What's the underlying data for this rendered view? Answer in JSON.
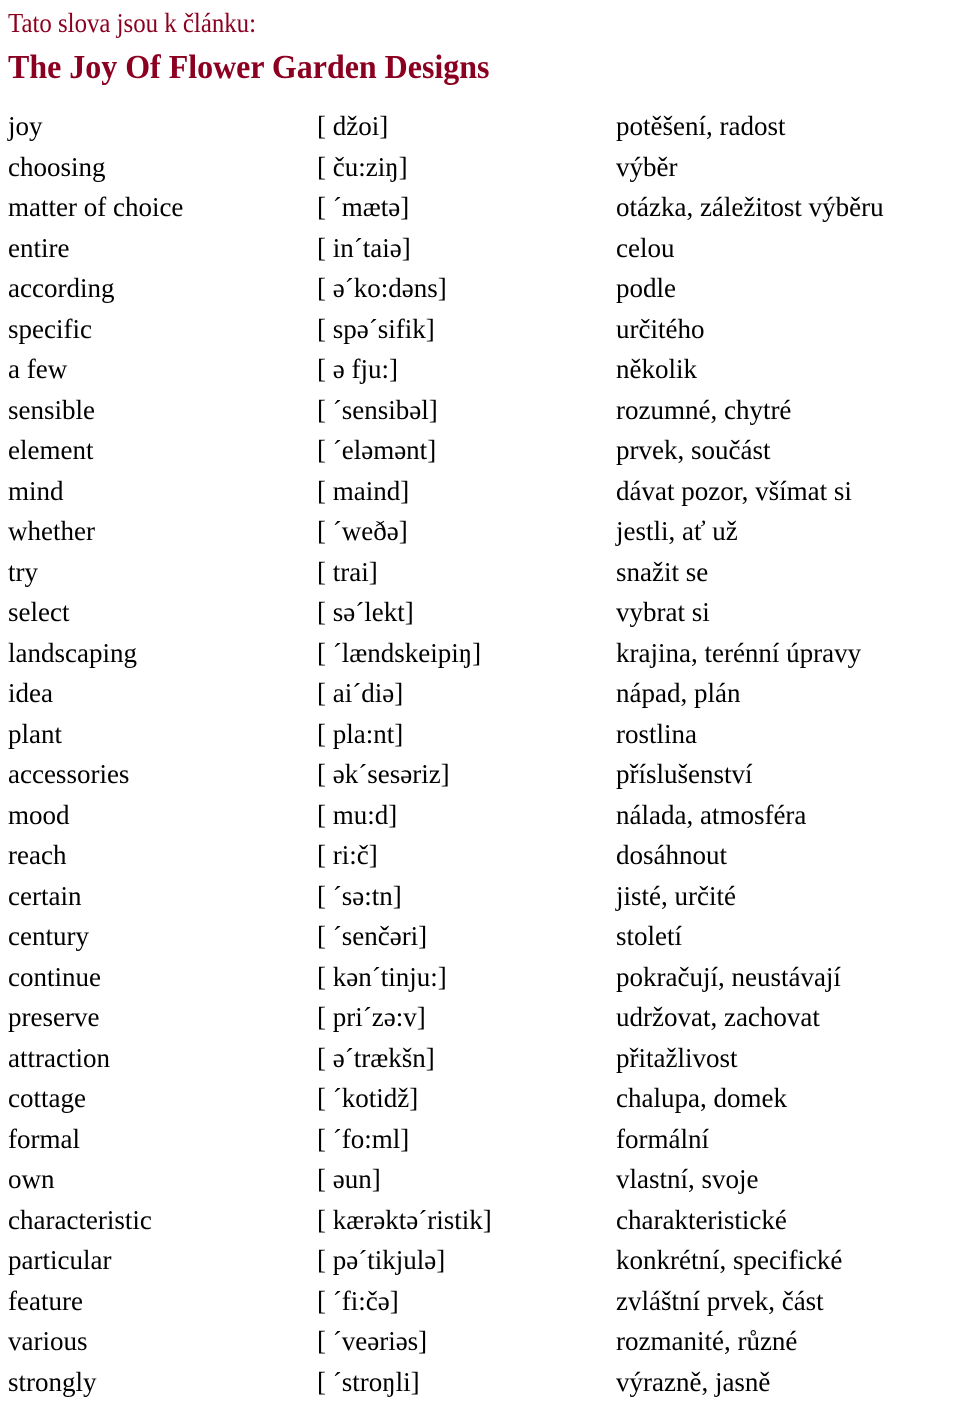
{
  "header": {
    "intro_line": "Tato slova jsou k článku:",
    "title": "The Joy Of Flower Garden Designs",
    "title_color": "#8B0020"
  },
  "vocabulary": {
    "rows": [
      {
        "term": "joy",
        "phonetic": "[ džoi]",
        "meaning": "potěšení, radost"
      },
      {
        "term": "choosing",
        "phonetic": "[ ču:ziŋ]",
        "meaning": "výběr"
      },
      {
        "term": "matter of choice",
        "phonetic": "[ ´mætə]",
        "meaning": "otázka, záležitost výběru"
      },
      {
        "term": "entire",
        "phonetic": "[ in´taiə]",
        "meaning": "celou"
      },
      {
        "term": "according",
        "phonetic": "[ ə´ko:dəns]",
        "meaning": "podle"
      },
      {
        "term": "specific",
        "phonetic": "[ spə´sifik]",
        "meaning": "určitého"
      },
      {
        "term": "a few",
        "phonetic": "[ ə fju:]",
        "meaning": "několik"
      },
      {
        "term": "sensible",
        "phonetic": "[ ´sensibəl]",
        "meaning": "rozumné, chytré"
      },
      {
        "term": "element",
        "phonetic": "[ ´eləmənt]",
        "meaning": "prvek, součást"
      },
      {
        "term": "mind",
        "phonetic": "[ maind]",
        "meaning": "dávat pozor, všímat si"
      },
      {
        "term": "whether",
        "phonetic": "[ ´weðə]",
        "meaning": "jestli, ať už"
      },
      {
        "term": "try",
        "phonetic": "[ trai]",
        "meaning": "snažit se"
      },
      {
        "term": "select",
        "phonetic": "[ sə´lekt]",
        "meaning": "vybrat si"
      },
      {
        "term": "landscaping",
        "phonetic": "[ ´lændskeipiŋ]",
        "meaning": "krajina, terénní úpravy"
      },
      {
        "term": "idea",
        "phonetic": "[ ai´diə]",
        "meaning": "nápad, plán"
      },
      {
        "term": "plant",
        "phonetic": "[ pla:nt]",
        "meaning": "rostlina"
      },
      {
        "term": "accessories",
        "phonetic": "[ ək´sesəriz]",
        "meaning": "příslušenství"
      },
      {
        "term": "mood",
        "phonetic": "[ mu:d]",
        "meaning": "nálada, atmosféra"
      },
      {
        "term": "reach",
        "phonetic": "[ ri:č]",
        "meaning": "dosáhnout"
      },
      {
        "term": "certain",
        "phonetic": "[ ´sə:tn]",
        "meaning": "jisté, určité"
      },
      {
        "term": "century",
        "phonetic": "[ ´senčəri]",
        "meaning": "století"
      },
      {
        "term": "continue",
        "phonetic": "[ kən´tinju:]",
        "meaning": "pokračují, neustávají"
      },
      {
        "term": "preserve",
        "phonetic": "[ pri´zə:v]",
        "meaning": "udržovat, zachovat"
      },
      {
        "term": "attraction",
        "phonetic": "[ ə´trækšn]",
        "meaning": "přitažlivost"
      },
      {
        "term": "cottage",
        "phonetic": "[ ´kotidž]",
        "meaning": "chalupa, domek"
      },
      {
        "term": "formal",
        "phonetic": "[ ´fo:ml]",
        "meaning": "formální"
      },
      {
        "term": "own",
        "phonetic": "[ əun]",
        "meaning": "vlastní, svoje"
      },
      {
        "term": "characteristic",
        "phonetic": "[ kærəktə´ristik]",
        "meaning": "charakteristické"
      },
      {
        "term": "particular",
        "phonetic": "[ pə´tikjulə]",
        "meaning": "konkrétní, specifické"
      },
      {
        "term": "feature",
        "phonetic": "[ ´fi:čə]",
        "meaning": "zvláštní prvek, část"
      },
      {
        "term": "various",
        "phonetic": "[ ´veəriəs]",
        "meaning": "rozmanité, různé"
      },
      {
        "term": "strongly",
        "phonetic": "[ ´stroŋli]",
        "meaning": "výrazně, jasně"
      }
    ]
  }
}
